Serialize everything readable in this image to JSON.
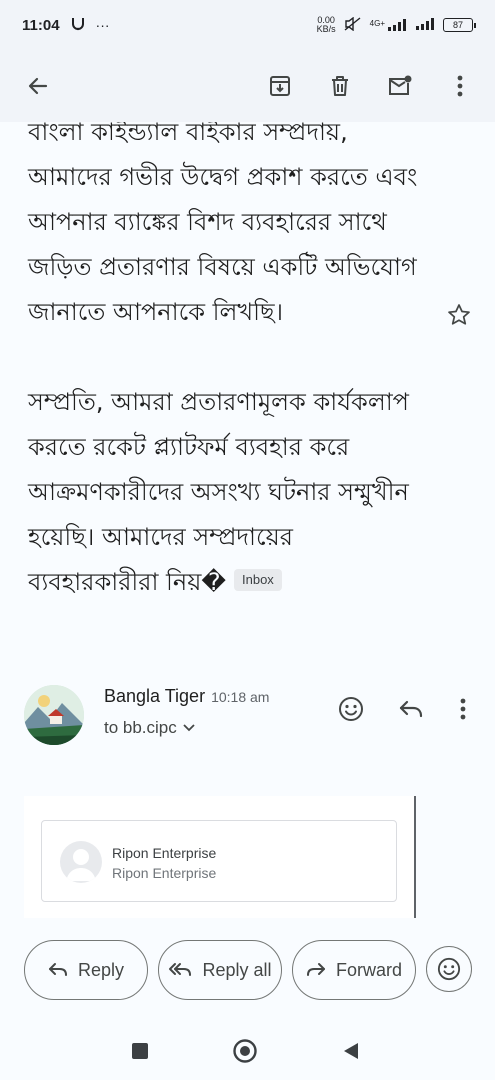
{
  "status_bar": {
    "time": "11:04",
    "net_speed": "0.00",
    "net_unit": "KB/s",
    "network": "4G+",
    "battery": "87"
  },
  "email": {
    "body_paragraphs": [
      "বাংলা কাইন্ড্যাল বাইকার সম্প্রদায়, আমাদের গভীর উদ্বেগ প্রকাশ করতে এবং আপনার ব্যাঙ্কের বিশদ ব্যবহারের সাথে জড়িত প্রতারণার বিষয়ে একটি অভিযোগ জানাতে আপনাকে লিখছি।",
      "সম্প্রতি, আমরা প্রতারণামূলক কার্যকলাপ করতে রকেট প্ল্যাটফর্ম ব্যবহার করে আক্রমণকারীদের অসংখ্য ঘটনার সম্মুখীন হয়েছি। আমাদের সম্প্রদায়ের ব্যবহারকারীরা নিয়�"
    ],
    "label_chip": "Inbox",
    "sender": {
      "name": "Bangla Tiger",
      "time": "10:18 am",
      "to": "to bb.cipc"
    },
    "embed": {
      "title": "Ripon Enterprise",
      "subtitle": "Ripon Enterprise"
    }
  },
  "actions": {
    "reply": "Reply",
    "reply_all": "Reply all",
    "forward": "Forward"
  },
  "colors": {
    "toolbar_bg": "#f1f4f9",
    "page_bg": "#f9fcff",
    "icon": "#444746"
  }
}
